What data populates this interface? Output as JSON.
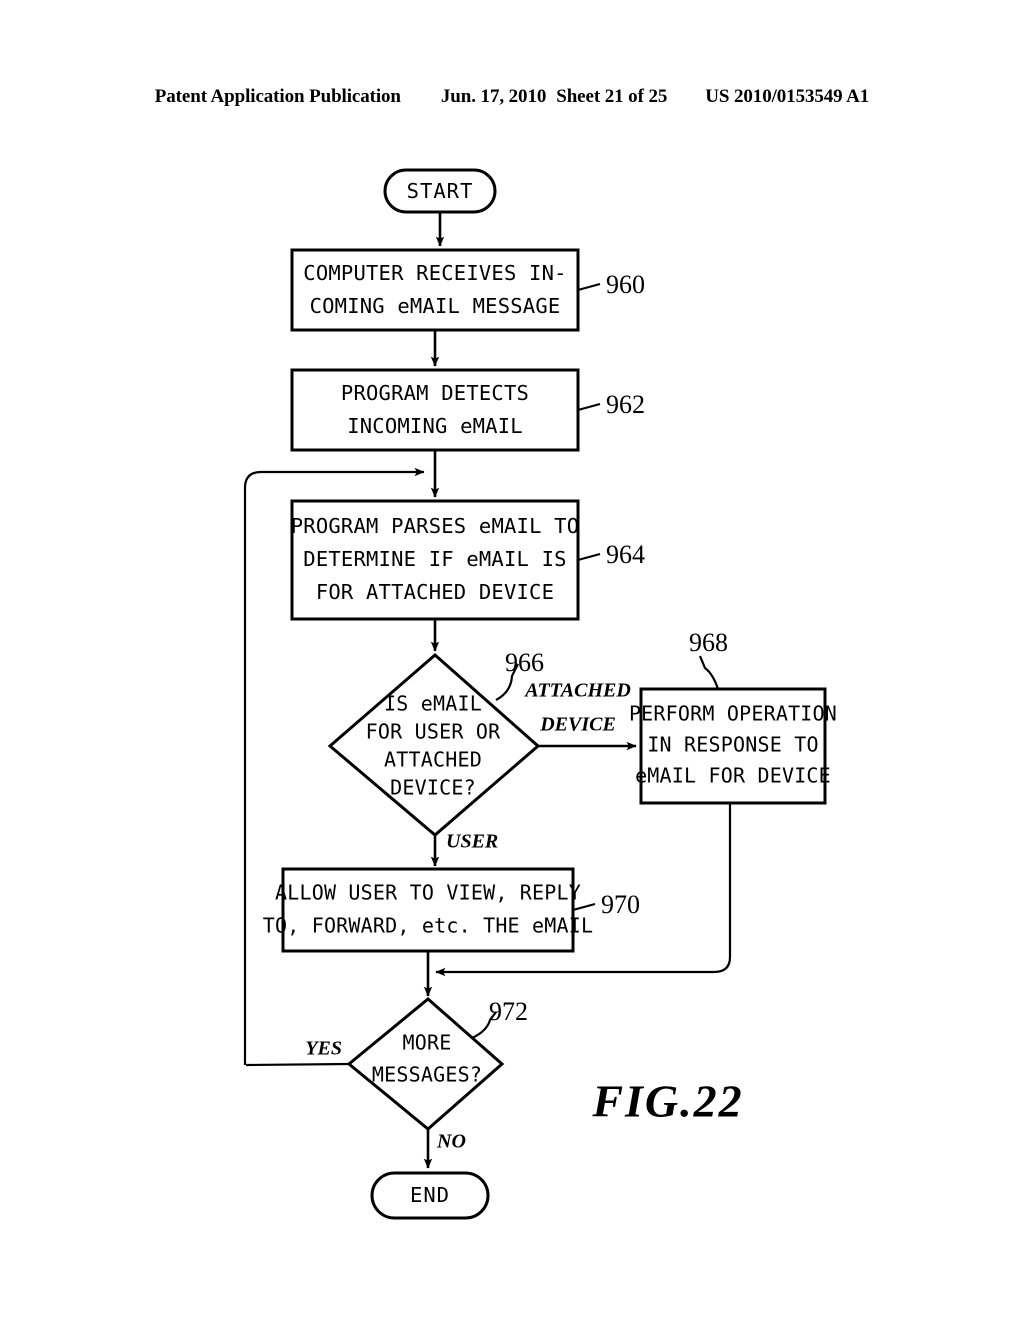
{
  "header": {
    "publication": "Patent Application Publication",
    "date": "Jun. 17, 2010",
    "sheet": "Sheet 21 of 25",
    "patent_number": "US 2010/0153549 A1"
  },
  "figure": {
    "caption": "FIG.22"
  },
  "flowchart": {
    "start_label": "START",
    "end_label": "END",
    "steps": [
      {
        "ref": "960",
        "lines": [
          "COMPUTER RECEIVES IN-",
          "COMING eMAIL MESSAGE"
        ]
      },
      {
        "ref": "962",
        "lines": [
          "PROGRAM DETECTS",
          "INCOMING eMAIL"
        ]
      },
      {
        "ref": "964",
        "lines": [
          "PROGRAM PARSES eMAIL TO",
          "DETERMINE IF eMAIL IS",
          "FOR ATTACHED DEVICE"
        ]
      },
      {
        "ref": "968",
        "lines": [
          "PERFORM OPERATION",
          "IN RESPONSE TO",
          "eMAIL FOR DEVICE"
        ]
      },
      {
        "ref": "970",
        "lines": [
          "ALLOW USER TO VIEW, REPLY",
          "TO, FORWARD, etc. THE eMAIL"
        ]
      }
    ],
    "decisions": [
      {
        "ref": "966",
        "lines": [
          "IS eMAIL",
          "FOR USER OR",
          "ATTACHED",
          "DEVICE?"
        ],
        "branch_right": [
          "ATTACHED",
          "DEVICE"
        ],
        "branch_down": "USER"
      },
      {
        "ref": "972",
        "lines": [
          "MORE",
          "MESSAGES?"
        ],
        "branch_left": "YES",
        "branch_down": "NO"
      }
    ]
  },
  "colors": {
    "ink": "#000000",
    "paper": "#ffffff"
  }
}
